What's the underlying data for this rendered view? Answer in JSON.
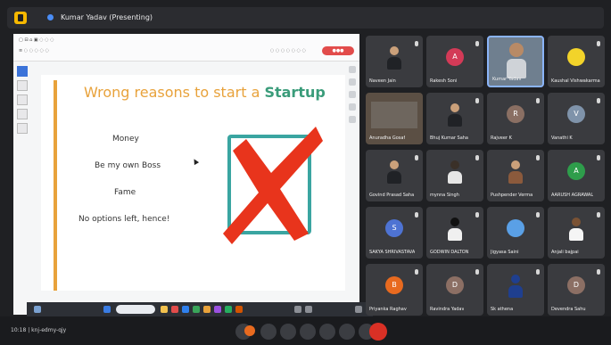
{
  "window": {
    "title": "Kumar Yadav (Presenting)"
  },
  "slide": {
    "title_part1": "Wrong reasons to start a ",
    "title_part2": "Startup",
    "bullets": [
      "Money",
      "Be my own Boss",
      "Fame",
      "No options left, hence!"
    ]
  },
  "participants": [
    {
      "name": "Naveen Jain",
      "letter": "",
      "color": "#3a3b3f",
      "type": "person"
    },
    {
      "name": "Rakesh Soni",
      "letter": "A",
      "color": "#d33a57",
      "type": "avatar"
    },
    {
      "name": "Kumar Yadav",
      "letter": "",
      "color": "#8fa3b8",
      "type": "speaker"
    },
    {
      "name": "Kaushal Vishwakarma",
      "letter": "",
      "color": "#f2d32a",
      "type": "avatar"
    },
    {
      "name": "Anuradha Gosaf",
      "letter": "",
      "color": "#5b4f44",
      "type": "room"
    },
    {
      "name": "Bhuj Kumar Saha",
      "letter": "",
      "color": "#3a3b3f",
      "type": "person"
    },
    {
      "name": "Rajveer K",
      "letter": "R",
      "color": "#8a6f63",
      "type": "avatar"
    },
    {
      "name": "Vanathi K",
      "letter": "V",
      "color": "#7f93aa",
      "type": "avatar"
    },
    {
      "name": "Govind Prasad Saha",
      "letter": "",
      "color": "#3a3b3f",
      "type": "person"
    },
    {
      "name": "mynna Singh",
      "letter": "",
      "color": "#3a3b3f",
      "type": "person"
    },
    {
      "name": "Pushpender Verma",
      "letter": "",
      "color": "#3a3b3f",
      "type": "person"
    },
    {
      "name": "AARUSH AGRAWAL",
      "letter": "A",
      "color": "#2e9d4b",
      "type": "avatar"
    },
    {
      "name": "SAKYA SHRIVASTAVA",
      "letter": "S",
      "color": "#4e73d3",
      "type": "avatar"
    },
    {
      "name": "GODWIN DALTON",
      "letter": "",
      "color": "#3a3b3f",
      "type": "person"
    },
    {
      "name": "Jigyasa Saini",
      "letter": "",
      "color": "#3a3b3f",
      "type": "globe"
    },
    {
      "name": "Anjali bajpai",
      "letter": "",
      "color": "#3a3b3f",
      "type": "person"
    },
    {
      "name": "Priyanka Raghav",
      "letter": "B",
      "color": "#e86a1f",
      "type": "avatar"
    },
    {
      "name": "Ravindra Yadav",
      "letter": "D",
      "color": "#8c6f64",
      "type": "avatar"
    },
    {
      "name": "Sk athena",
      "letter": "",
      "color": "#3a3b3f",
      "type": "person"
    },
    {
      "name": "Devendra Sahu",
      "letter": "D",
      "color": "#8c6f64",
      "type": "avatar"
    }
  ],
  "bottom": {
    "time_meeting": "10:18  |  knj-edmy-qjy"
  },
  "colors": {
    "accent_orange": "#e8a23b",
    "accent_green": "#3a9c7a",
    "box_teal": "#3aa5a1",
    "cross_red": "#e8341c"
  },
  "icons": [
    "microphone-icon",
    "camera-icon",
    "present-icon",
    "more-icon",
    "end-call-icon",
    "info-icon",
    "people-icon",
    "chat-icon"
  ]
}
